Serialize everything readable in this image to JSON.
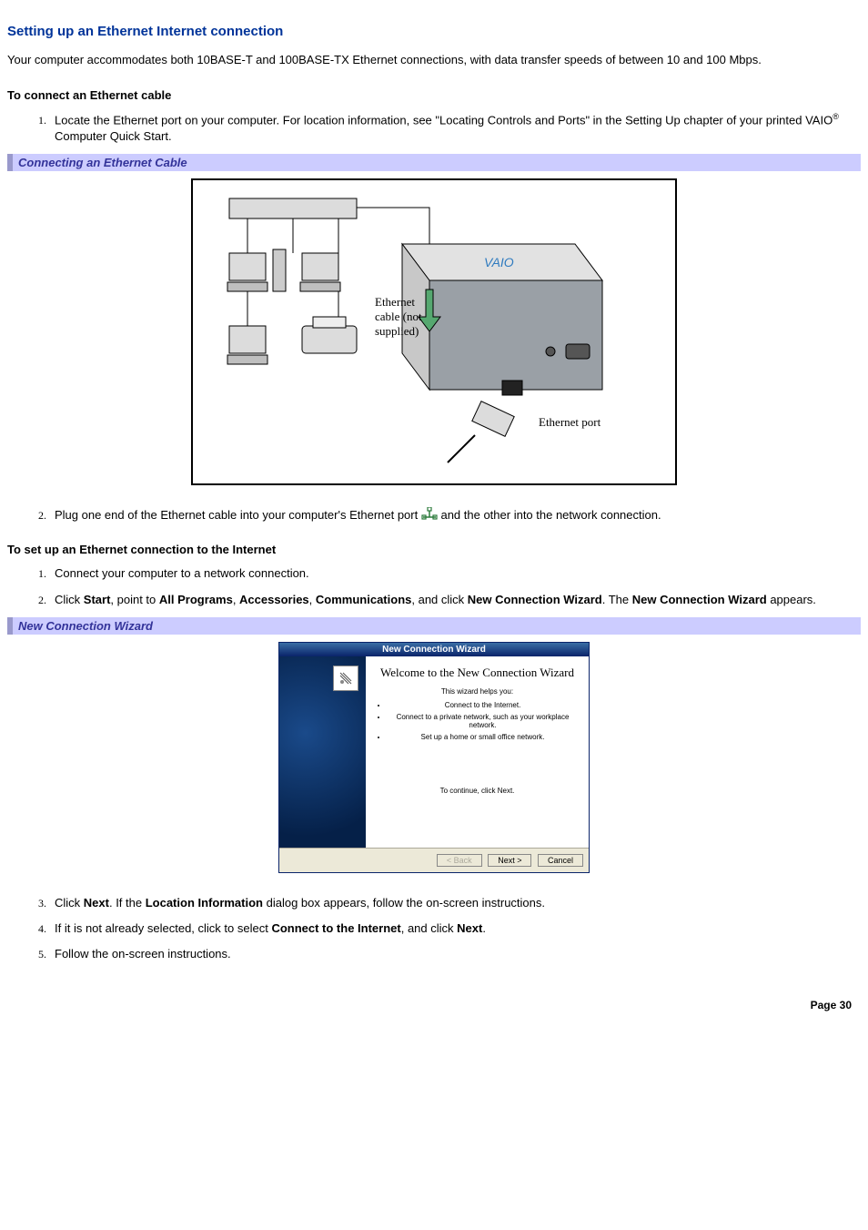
{
  "title": "Setting up an Ethernet Internet connection",
  "intro": "Your computer accommodates both 10BASE-T and 100BASE-TX Ethernet connections, with data transfer speeds of between 10 and 100 Mbps.",
  "cable_section": {
    "heading": "To connect an Ethernet cable",
    "step1_a": "Locate the Ethernet port on your computer. For location information, see \"Locating Controls and Ports\" in the Setting Up chapter of your printed VAIO",
    "step1_b": " Computer Quick Start.",
    "caption": "Connecting an Ethernet Cable",
    "diagram_label_cable": "Ethernet cable (not supplied)",
    "diagram_label_port": "Ethernet port",
    "step2_a": "Plug one end of the Ethernet cable into your computer's Ethernet port ",
    "step2_b": "and the other into the network connection."
  },
  "setup_section": {
    "heading": "To set up an Ethernet connection to the Internet",
    "step1": "Connect your computer to a network connection.",
    "step2_a": "Click ",
    "step2_b": "Start",
    "step2_c": ", point to ",
    "step2_d": "All Programs",
    "step2_e": ", ",
    "step2_f": "Accessories",
    "step2_g": ", ",
    "step2_h": "Communications",
    "step2_i": ", and click ",
    "step2_j": "New Connection Wizard",
    "step2_k": ". The ",
    "step2_l": "New Connection Wizard",
    "step2_m": " appears.",
    "caption": "New Connection Wizard",
    "step3_a": "Click ",
    "step3_b": "Next",
    "step3_c": ". If the ",
    "step3_d": "Location Information",
    "step3_e": " dialog box appears, follow the on-screen instructions.",
    "step4_a": "If it is not already selected, click to select ",
    "step4_b": "Connect to the Internet",
    "step4_c": ", and click ",
    "step4_d": "Next",
    "step4_e": ".",
    "step5": "Follow the on-screen instructions."
  },
  "wizard": {
    "window_title": "New Connection Wizard",
    "heading": "Welcome to the New Connection Wizard",
    "helps": "This wizard helps you:",
    "b1": "Connect to the Internet.",
    "b2": "Connect to a private network, such as your workplace network.",
    "b3": "Set up a home or small office network.",
    "continue": "To continue, click Next.",
    "back": "< Back",
    "next": "Next >",
    "cancel": "Cancel"
  },
  "page_number": "Page 30"
}
